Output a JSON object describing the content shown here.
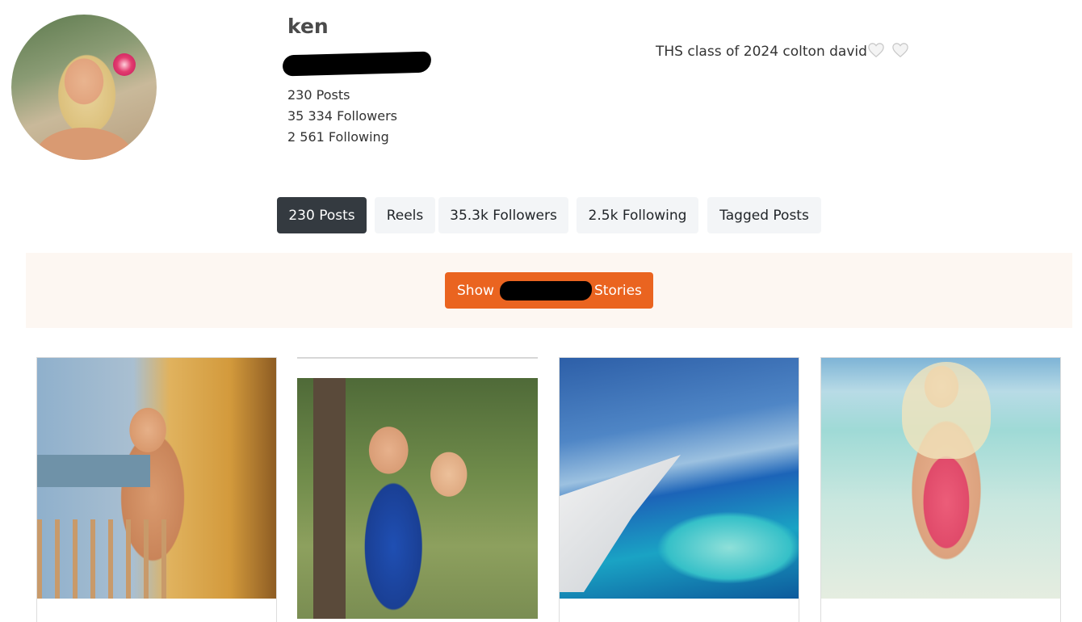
{
  "profile": {
    "username": "ken",
    "posts": "230 Posts",
    "followers": "35 334 Followers",
    "following": "2 561 Following",
    "bio": "THS class of 2024 colton david"
  },
  "tabs": [
    {
      "label": "230 Posts",
      "active": true
    },
    {
      "label": "Reels",
      "active": false
    },
    {
      "label": "35.3k Followers",
      "active": false
    },
    {
      "label": "2.5k Following",
      "active": false
    },
    {
      "label": "Tagged Posts",
      "active": false
    }
  ],
  "stories": {
    "label_start": "Show",
    "label_end": "Stories",
    "color": "#ea6420"
  },
  "posts": [
    {
      "subject": "girl-on-balcony"
    },
    {
      "subject": "two-girls-hugging"
    },
    {
      "subject": "airplane-wing-over-ocean"
    },
    {
      "subject": "girl-in-pink-swimsuit"
    }
  ],
  "colors": {
    "active_tab": "#343a40",
    "tab": "#f3f5f7",
    "banner": "#fdf7f2"
  },
  "icons": [
    "heart-outline-icon",
    "heart-outline-icon"
  ]
}
